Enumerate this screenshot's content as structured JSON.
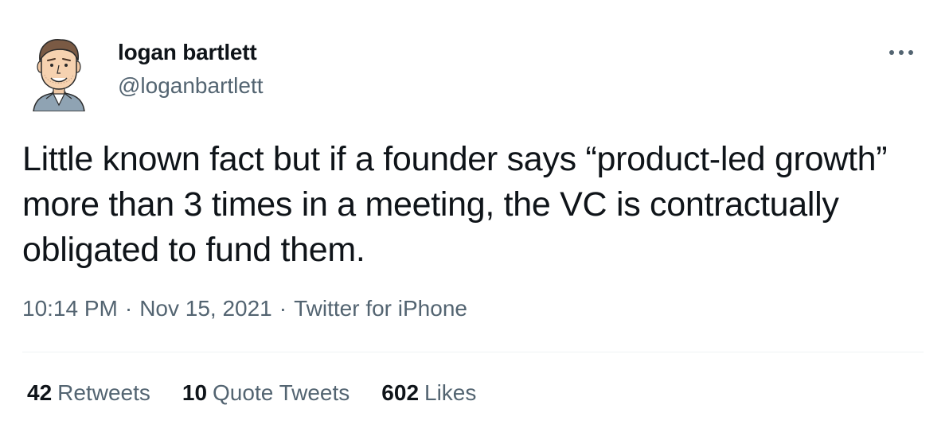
{
  "author": {
    "display_name": "logan bartlett",
    "handle": "@loganbartlett",
    "avatar_icon": "cartoon-avatar-icon"
  },
  "more_icon": "more-dots-icon",
  "tweet": {
    "text": "Little known fact but if a founder says “product-led growth” more than 3 times in a meeting, the VC is contractually obligated to fund them."
  },
  "meta": {
    "time": "10:14 PM",
    "separator": "·",
    "date": "Nov 15, 2021",
    "source": "Twitter for iPhone"
  },
  "stats": {
    "retweets_count": "42",
    "retweets_label": "Retweets",
    "quote_tweets_count": "10",
    "quote_tweets_label": "Quote Tweets",
    "likes_count": "602",
    "likes_label": "Likes"
  },
  "colors": {
    "text_primary": "#0f1419",
    "text_secondary": "#536471",
    "divider": "#eff3f4"
  }
}
